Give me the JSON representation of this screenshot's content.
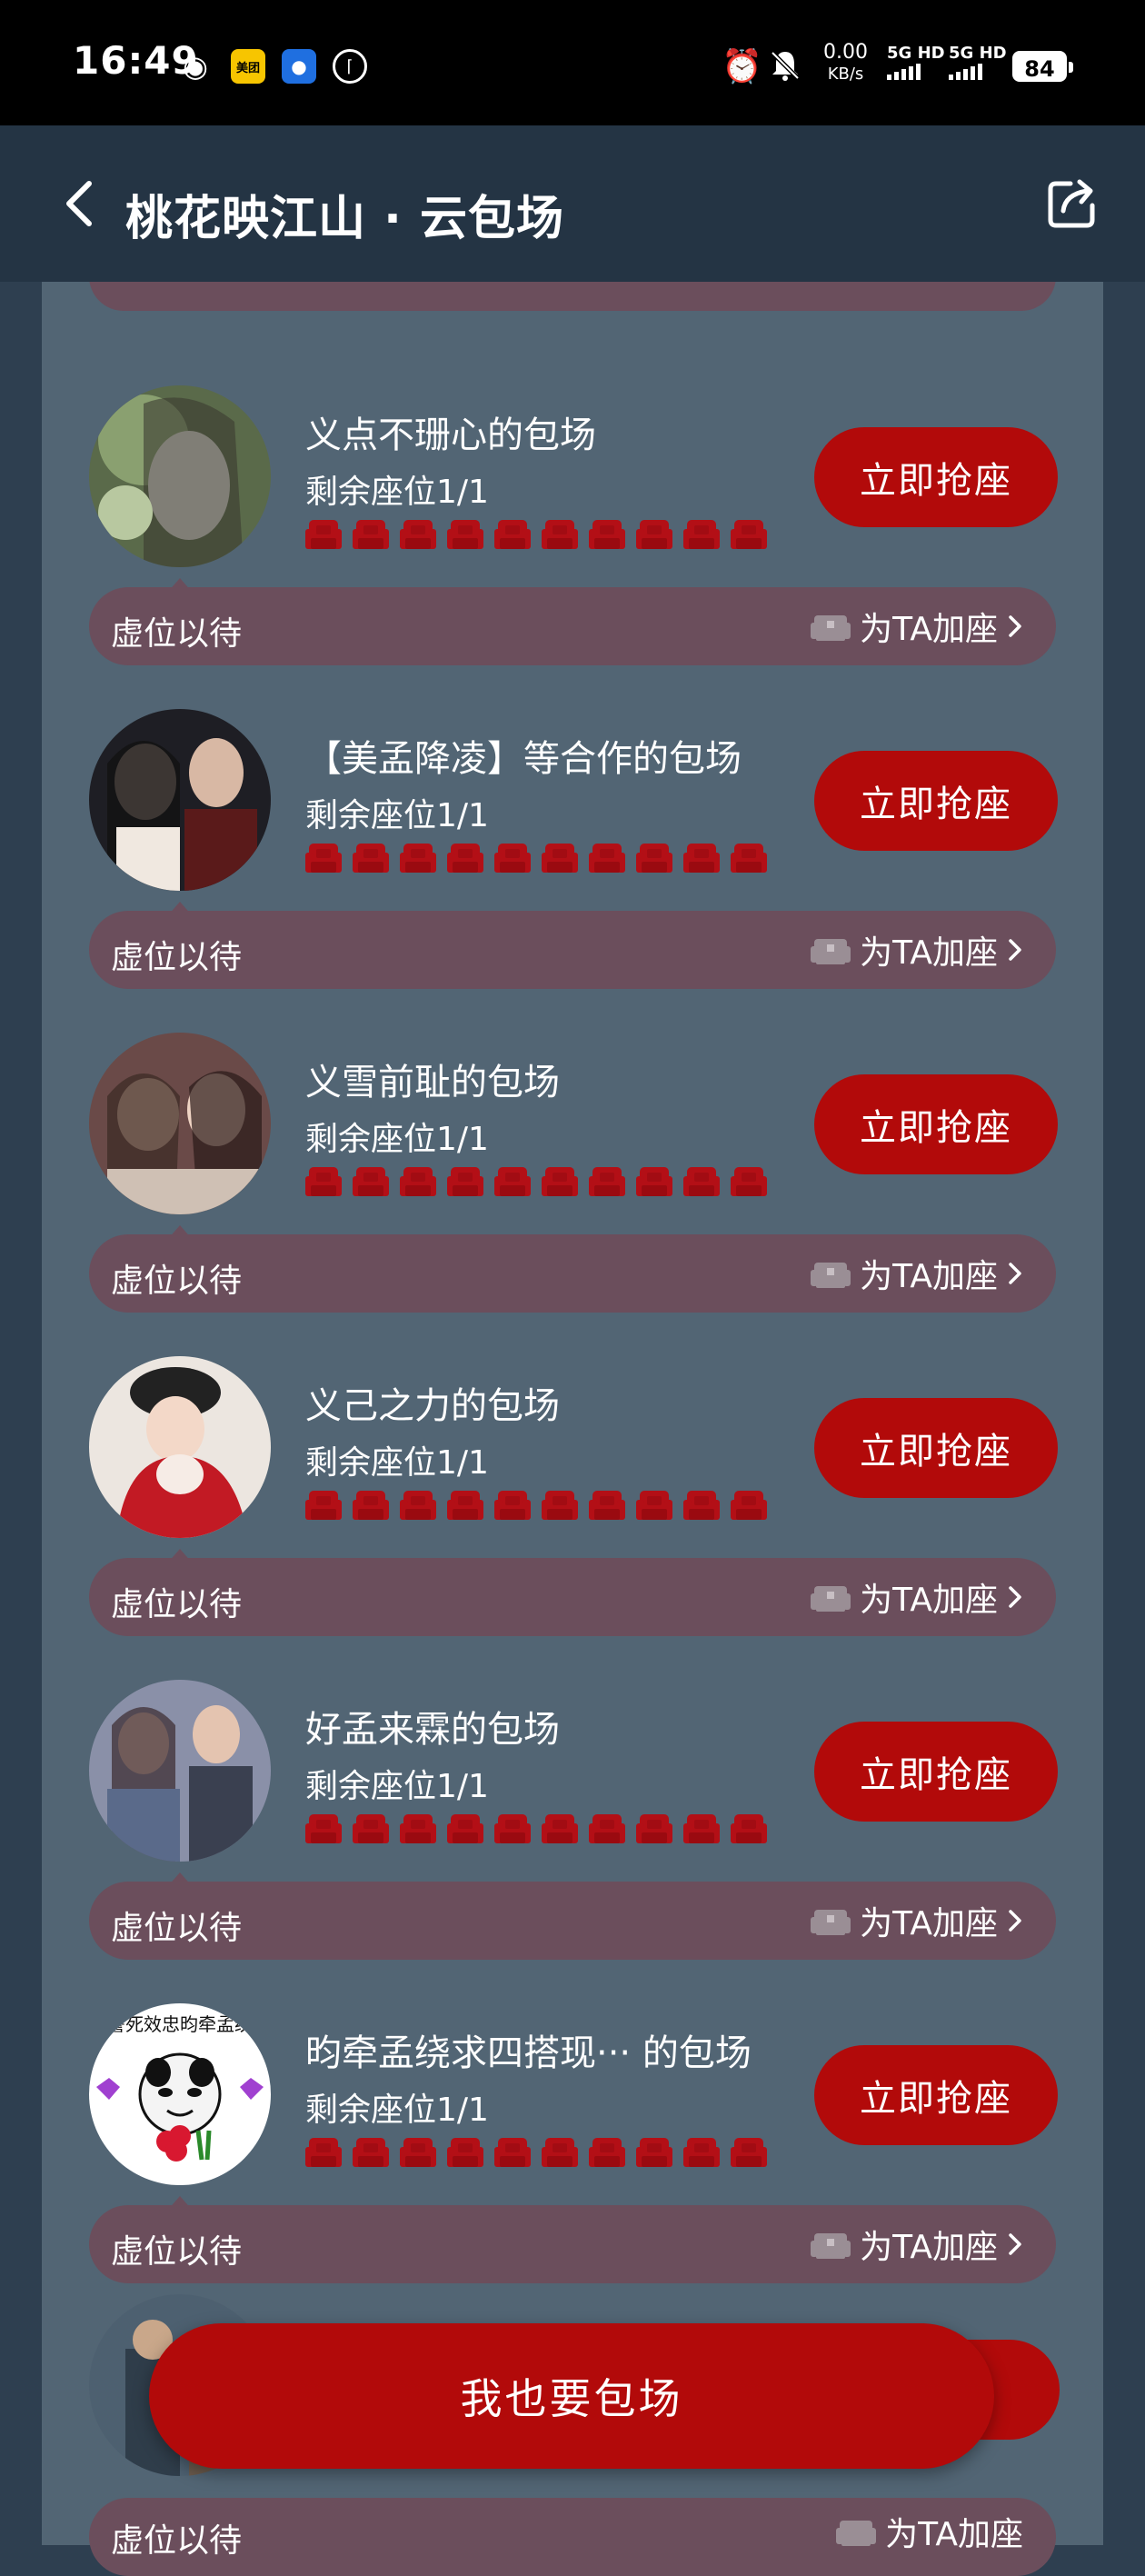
{
  "status_bar": {
    "time": "16:49",
    "net_speed_value": "0.00",
    "net_speed_unit": "KB/s",
    "sim1": "5G HD",
    "sim2": "5G HD",
    "battery": "84"
  },
  "header": {
    "title": "桃花映江山 · 云包场"
  },
  "cards": [
    {
      "title": "义点不珊心的包场",
      "seats": "剩余座位1/1",
      "button": "立即抢座",
      "wait": "虚位以待",
      "add_seat": "为TA加座"
    },
    {
      "title": "【美孟降凌】等合作的包场",
      "seats": "剩余座位1/1",
      "button": "立即抢座",
      "wait": "虚位以待",
      "add_seat": "为TA加座"
    },
    {
      "title": "义雪前耻的包场",
      "seats": "剩余座位1/1",
      "button": "立即抢座",
      "wait": "虚位以待",
      "add_seat": "为TA加座"
    },
    {
      "title": "义己之力的包场",
      "seats": "剩余座位1/1",
      "button": "立即抢座",
      "wait": "虚位以待",
      "add_seat": "为TA加座"
    },
    {
      "title": "好孟来霖的包场",
      "seats": "剩余座位1/1",
      "button": "立即抢座",
      "wait": "虚位以待",
      "add_seat": "为TA加座"
    },
    {
      "title": "昀牵孟绕求四搭现··· 的包场",
      "seats": "剩余座位1/1",
      "button": "立即抢座",
      "wait": "虚位以待",
      "add_seat": "为TA加座"
    }
  ],
  "partial_card": {
    "wait": "虚位以待",
    "add_seat": "为TA加座"
  },
  "avatar_caption": "誓死效忠昀牵孟绕",
  "cta_label": "我也要包场",
  "colors": {
    "accent_red": "#b20a0a",
    "panel": "#526574",
    "bar": "#6b4e5c",
    "seat_red": "#b30f16"
  }
}
